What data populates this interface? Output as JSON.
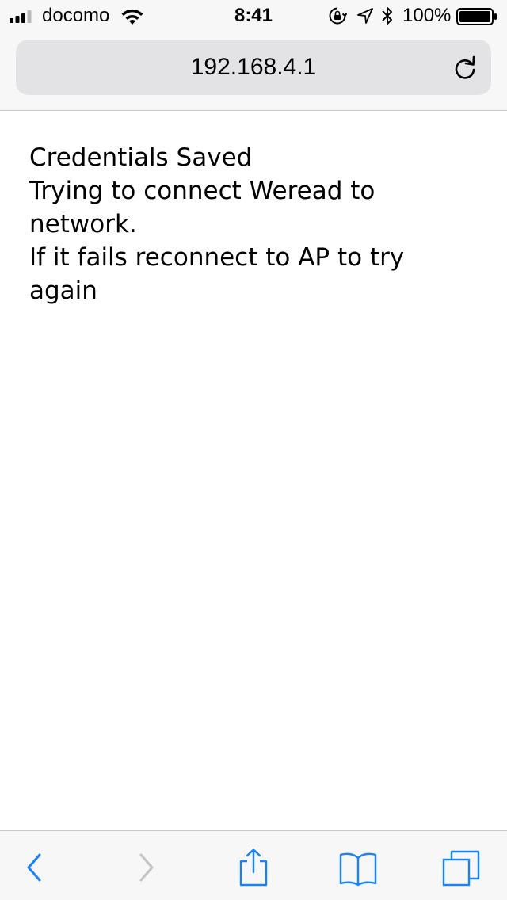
{
  "status_bar": {
    "carrier": "docomo",
    "time": "8:41",
    "battery_percent": "100%",
    "signal_bars": 3,
    "signal_icon": "signal-bars-icon",
    "wifi_icon": "wifi-icon",
    "orientation_lock_icon": "orientation-lock-icon",
    "location_icon": "location-arrow-icon",
    "bluetooth_icon": "bluetooth-icon",
    "battery_icon": "battery-icon",
    "battery_level": 1.0
  },
  "address_bar": {
    "url": "192.168.4.1",
    "reload_icon": "reload-icon"
  },
  "page": {
    "lines": [
      "Credentials Saved",
      "Trying to connect Weread to network.",
      "If it fails reconnect to AP to try again"
    ]
  },
  "toolbar": {
    "back_icon": "chevron-left-icon",
    "forward_icon": "chevron-right-icon",
    "share_icon": "share-icon",
    "bookmarks_icon": "book-icon",
    "tabs_icon": "tabs-icon",
    "back_enabled": true,
    "forward_enabled": false
  },
  "colors": {
    "accent": "#1a82fb",
    "disabled": "#c4c4c8",
    "chrome_bg": "#f7f7f7",
    "address_bg": "#e3e3e5"
  }
}
